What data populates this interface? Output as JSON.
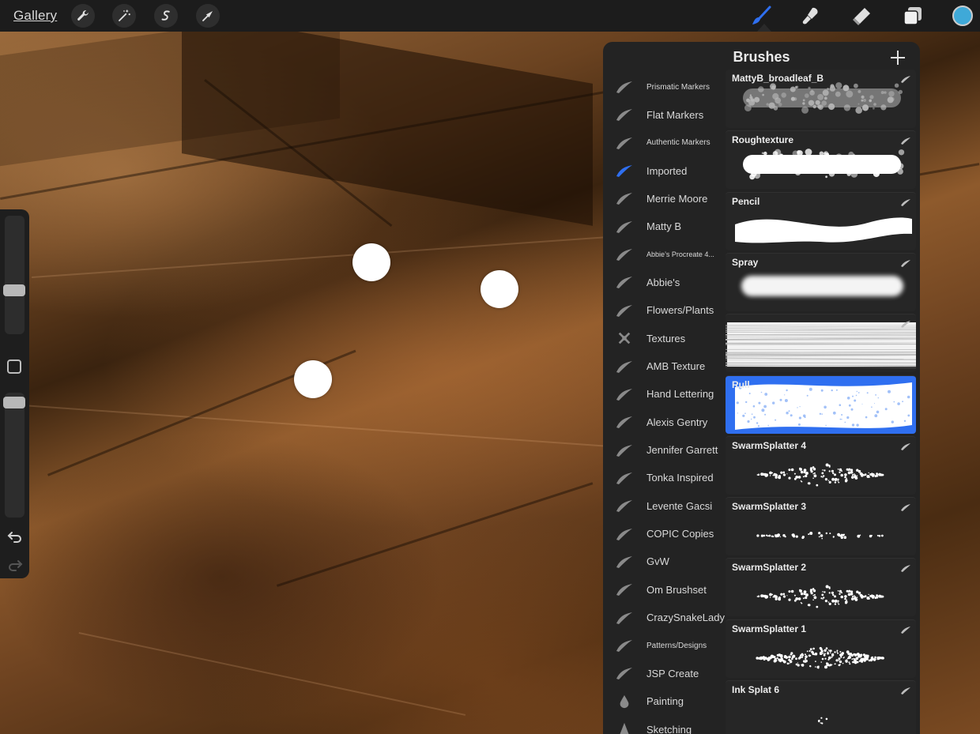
{
  "topbar": {
    "gallery_label": "Gallery",
    "left_tools": [
      {
        "name": "wrench-icon"
      },
      {
        "name": "magic-wand-icon"
      },
      {
        "name": "selection-s-icon"
      },
      {
        "name": "transform-arrow-icon"
      }
    ],
    "right_tools": [
      {
        "name": "brush-icon",
        "active": true
      },
      {
        "name": "smudge-icon"
      },
      {
        "name": "eraser-icon"
      },
      {
        "name": "layers-icon"
      }
    ],
    "current_color": "#3fa9d8",
    "accent_color": "#2f6ff0"
  },
  "panel": {
    "title": "Brushes",
    "add_label": "+",
    "sets": [
      {
        "label": "Prismatic Markers",
        "icon": "stroke-icon",
        "size": "small"
      },
      {
        "label": "Flat Markers",
        "icon": "stroke-icon"
      },
      {
        "label": "Authentic Markers",
        "icon": "stroke-icon",
        "size": "small"
      },
      {
        "label": "Imported",
        "icon": "stroke-icon",
        "active": true
      },
      {
        "label": "Merrie Moore",
        "icon": "stroke-icon"
      },
      {
        "label": "Matty B",
        "icon": "stroke-icon"
      },
      {
        "label": "Abbie’s Procreate 4...",
        "icon": "stroke-icon",
        "size": "tiny"
      },
      {
        "label": "Abbie's",
        "icon": "stroke-icon"
      },
      {
        "label": "Flowers/Plants",
        "icon": "stroke-icon"
      },
      {
        "label": "Textures",
        "icon": "textures-icon"
      },
      {
        "label": "AMB Texture",
        "icon": "stroke-icon"
      },
      {
        "label": "Hand Lettering",
        "icon": "stroke-icon"
      },
      {
        "label": "Alexis Gentry",
        "icon": "stroke-icon"
      },
      {
        "label": "Jennifer Garrett",
        "icon": "stroke-icon"
      },
      {
        "label": "Tonka Inspired",
        "icon": "stroke-icon"
      },
      {
        "label": "Levente Gacsi",
        "icon": "stroke-icon"
      },
      {
        "label": "COPIC Copies",
        "icon": "stroke-icon"
      },
      {
        "label": "GvW",
        "icon": "stroke-icon"
      },
      {
        "label": "Om Brushset",
        "icon": "stroke-icon"
      },
      {
        "label": "CrazySnakeLady",
        "icon": "stroke-icon"
      },
      {
        "label": "Patterns/Designs",
        "icon": "stroke-icon",
        "size": "small"
      },
      {
        "label": "JSP Create",
        "icon": "stroke-icon"
      },
      {
        "label": "Painting",
        "icon": "drop-icon"
      },
      {
        "label": "Sketching",
        "icon": "cone-icon"
      }
    ],
    "brushes": [
      {
        "name": "MattyB_broadleaf_B",
        "stroke": "rough-grey"
      },
      {
        "name": "Roughtexture",
        "stroke": "rough"
      },
      {
        "name": "Pencil",
        "stroke": "wave"
      },
      {
        "name": "Spray",
        "stroke": "soft"
      },
      {
        "name": "",
        "stroke": "dry"
      },
      {
        "name": "Rull",
        "stroke": "selected-wave",
        "selected": true
      },
      {
        "name": "SwarmSplatter 4",
        "stroke": "splatter"
      },
      {
        "name": "SwarmSplatter 3",
        "stroke": "splatter-thin"
      },
      {
        "name": "SwarmSplatter 2",
        "stroke": "splatter"
      },
      {
        "name": "SwarmSplatter 1",
        "stroke": "splatter-dense"
      },
      {
        "name": "Ink Splat 6",
        "stroke": "ink"
      }
    ]
  }
}
